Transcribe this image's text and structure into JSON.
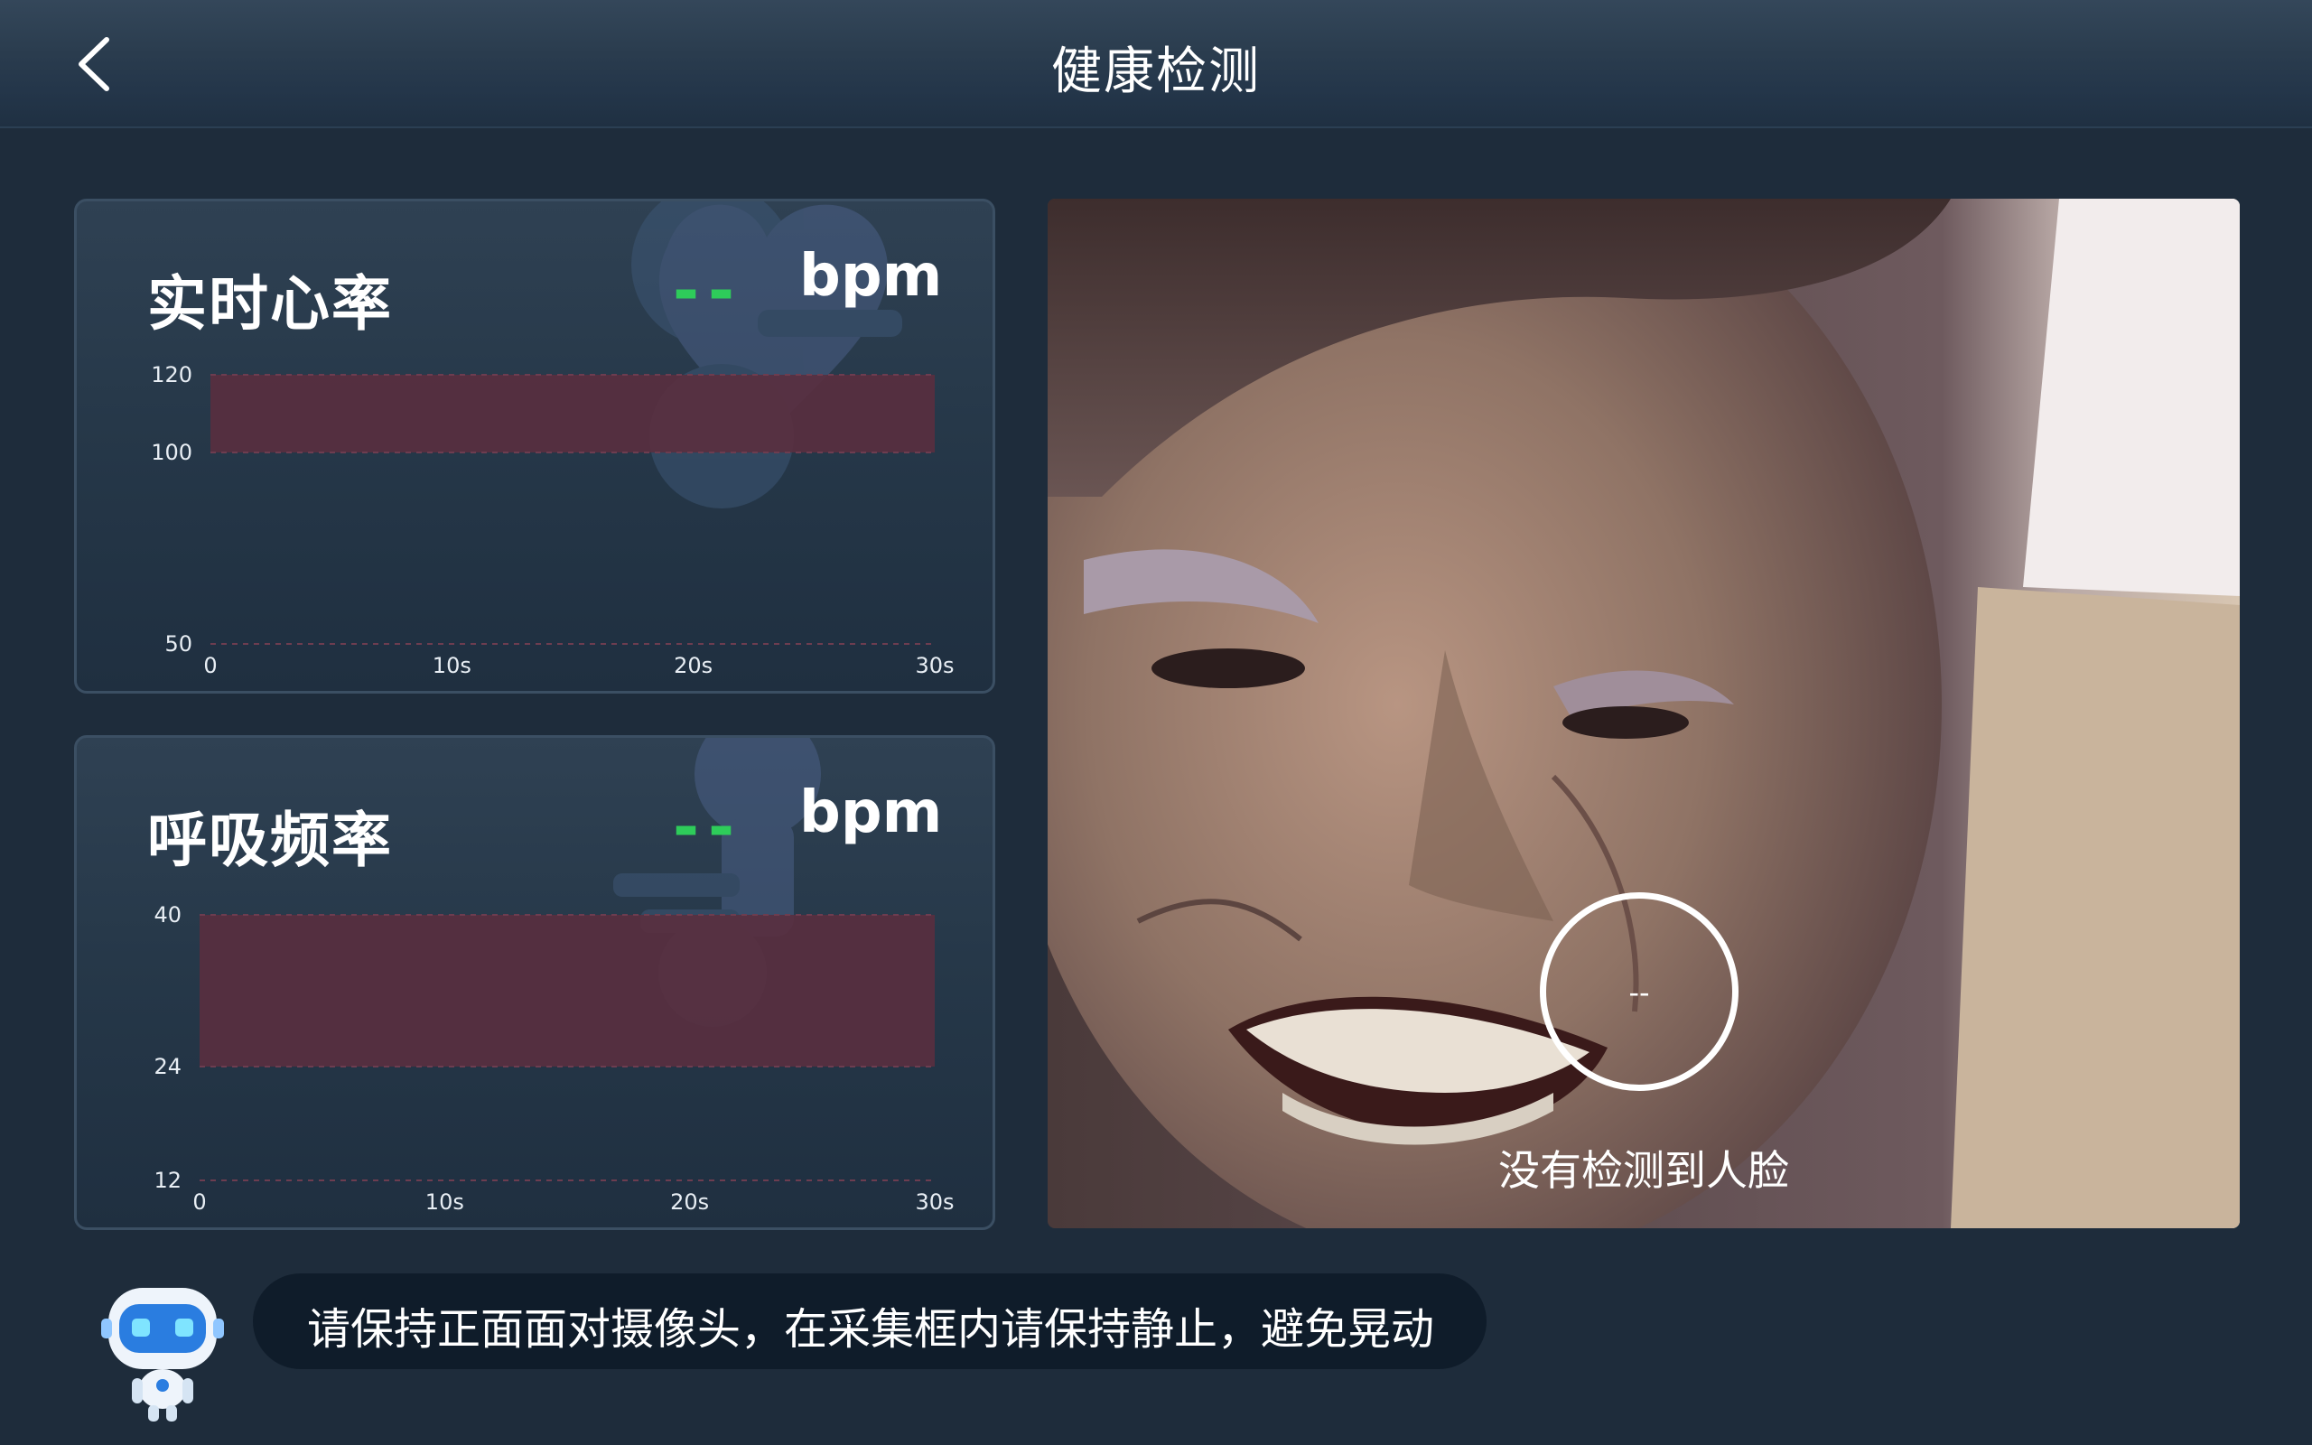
{
  "header": {
    "title": "健康检测",
    "back_icon": "chevron-left-icon"
  },
  "heart_rate": {
    "title": "实时心率",
    "value": "--",
    "unit": "bpm",
    "icon": "heart-icon",
    "chart_data": {
      "type": "area",
      "title": "",
      "y_ticks": [
        "120",
        "100",
        "50"
      ],
      "x_ticks": [
        "0",
        "10s",
        "20s",
        "30s"
      ],
      "normal_range": [
        100,
        120
      ],
      "ylim": [
        50,
        120
      ],
      "xlim": [
        0,
        30
      ],
      "series": []
    }
  },
  "respiration": {
    "title": "呼吸频率",
    "value": "--",
    "unit": "bpm",
    "icon": "lungs-icon",
    "chart_data": {
      "type": "area",
      "title": "",
      "y_ticks": [
        "40",
        "24",
        "12"
      ],
      "x_ticks": [
        "0",
        "10s",
        "20s",
        "30s"
      ],
      "normal_range": [
        24,
        40
      ],
      "ylim": [
        12,
        40
      ],
      "xlim": [
        0,
        30
      ],
      "series": []
    }
  },
  "camera": {
    "ring_value": "--",
    "status": "没有检测到人脸"
  },
  "tip": {
    "text": "请保持正面面对摄像头，在采集框内请保持静止，避免晃动",
    "avatar_icon": "robot-icon"
  },
  "colors": {
    "accent_green": "#2ecc5a",
    "range_band": "#5a2f3f",
    "background": "#1e2c3b"
  }
}
